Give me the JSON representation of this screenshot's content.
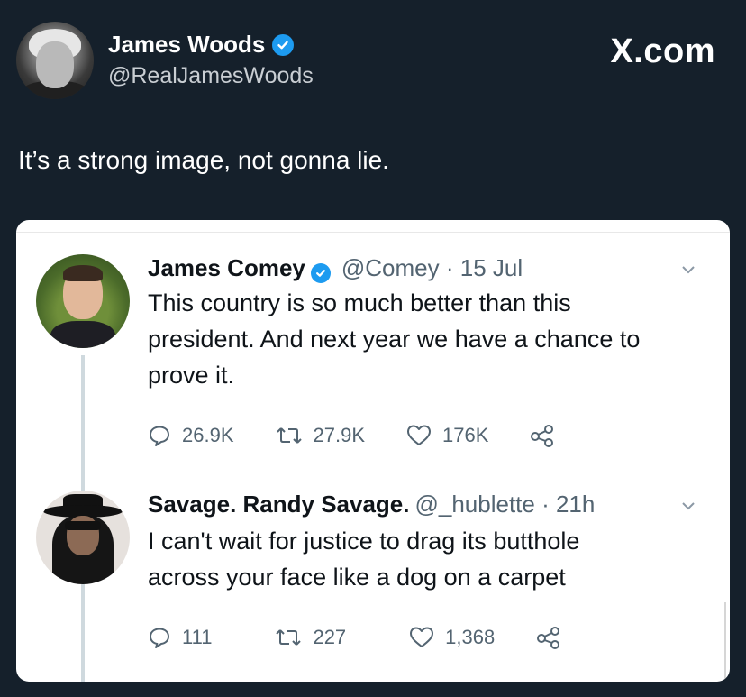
{
  "outer": {
    "display_name": "James Woods",
    "handle": "@RealJamesWoods",
    "watermark": "X.com",
    "text": "It’s a strong image, not gonna lie."
  },
  "embedded": [
    {
      "name": "James Comey",
      "verified": true,
      "meta": "@Comey · 15 Jul",
      "text": "This country is so much better than this\npresident.  And next year we have a chance to\nprove it.",
      "replies": "26.9K",
      "retweets": "27.9K",
      "likes": "176K"
    },
    {
      "name": "Savage. Randy Savage.",
      "verified": false,
      "meta": "@_hublette · 21h",
      "text": "I can't wait for justice to drag its butthole\nacross your face like a dog on a carpet",
      "replies": "111",
      "retweets": "227",
      "likes": "1,368"
    }
  ],
  "colors": {
    "background": "#15202b",
    "verified": "#1d9bf0",
    "card": "#ffffff"
  },
  "icons": [
    "verified-badge-icon",
    "chevron-down-icon",
    "reply-icon",
    "retweet-icon",
    "like-icon",
    "share-icon"
  ]
}
